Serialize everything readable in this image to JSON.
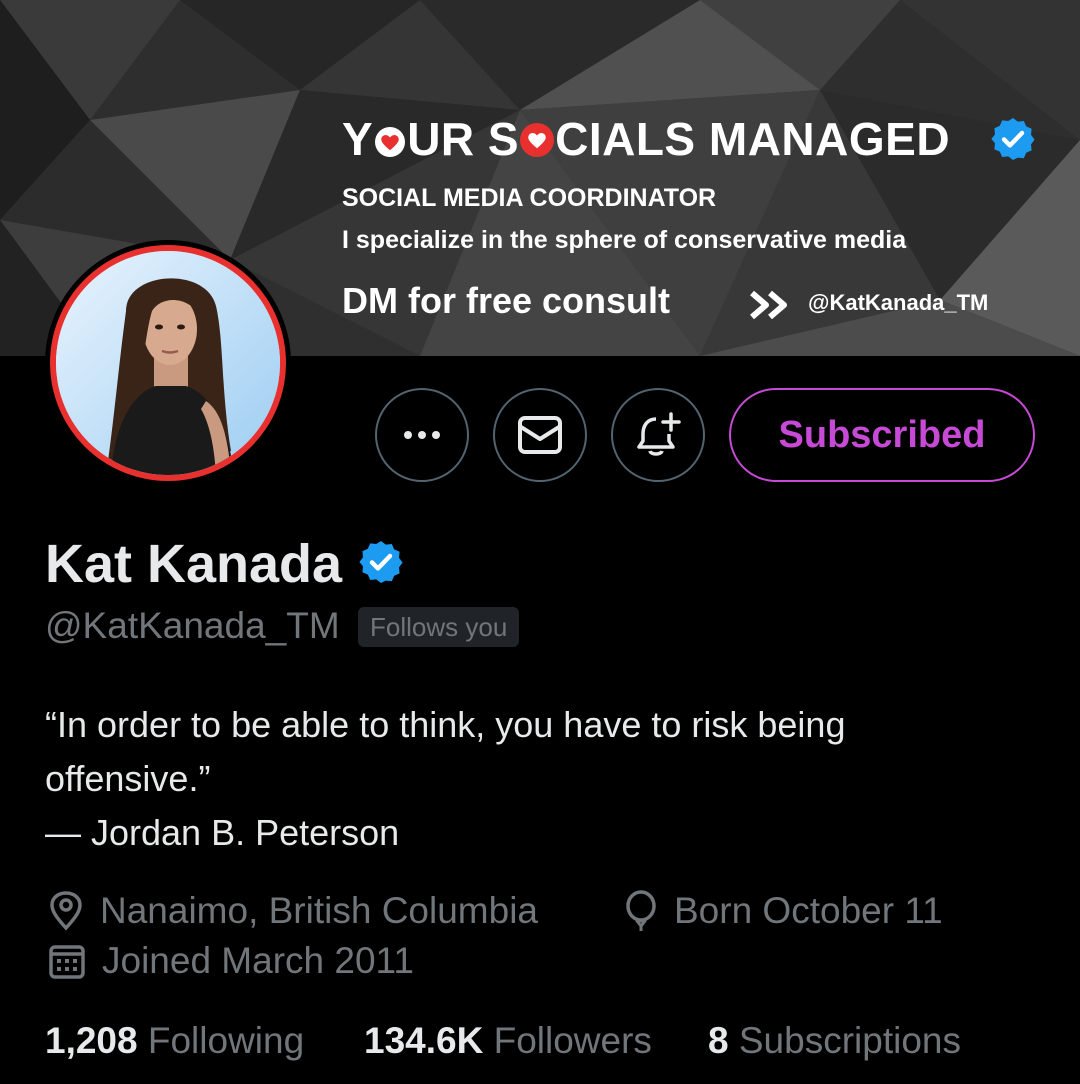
{
  "banner": {
    "headline_parts": [
      "Y",
      "UR S",
      "CIALS MANAGED"
    ],
    "subtitle": "SOCIAL MEDIA COORDINATOR",
    "tagline": "I specialize in the sphere of conservative media",
    "cta": "DM for free consult",
    "handle": "@KatKanada_TM"
  },
  "profile": {
    "display_name": "Kat Kanada",
    "handle": "@KatKanada_TM",
    "follows_badge": "Follows you",
    "bio_lines": [
      "“In order to be able to think, you have to risk being",
      "offensive.”",
      "— Jordan B. Peterson"
    ],
    "location": "Nanaimo, British Columbia",
    "birthday": "Born October 11",
    "joined": "Joined March 2011"
  },
  "actions": {
    "more_icon": "more-icon",
    "message_icon": "envelope-icon",
    "notify_icon": "bell-plus-icon",
    "subscribed_label": "Subscribed"
  },
  "stats": {
    "following_count": "1,208",
    "following_label": "Following",
    "followers_count": "134.6K",
    "followers_label": "Followers",
    "subscriptions_count": "8",
    "subscriptions_label": "Subscriptions"
  },
  "colors": {
    "background": "#000000",
    "text_primary": "#e7e9ea",
    "text_secondary": "#71767b",
    "verified_blue": "#1d9bf0",
    "subscribed_purple": "#c74ad6",
    "avatar_ring": "#e8302f"
  }
}
